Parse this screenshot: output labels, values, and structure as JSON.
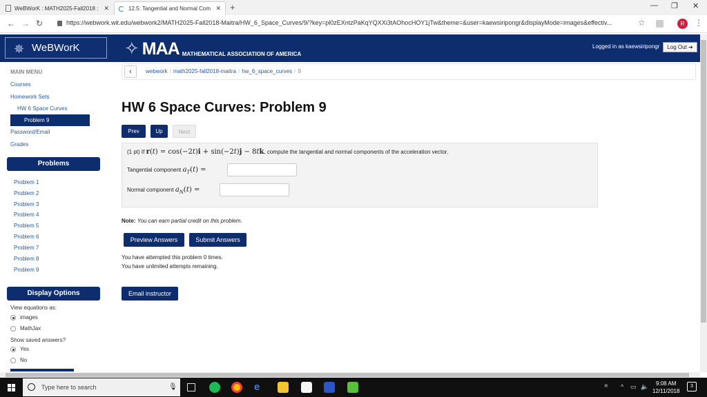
{
  "browser": {
    "tabs": [
      {
        "title": "WeBWorK : MATH2025-Fall2018 :"
      },
      {
        "title": "12.5: Tangential and Normal Com"
      }
    ],
    "new_tab": "+",
    "url": "https://webwork.wit.edu/webwork2/MATH2025-Fall2018-Maitra/HW_6_Space_Curves/9/?key=pl0zEXntzPaKqYQXXi3tAOhocHOY1jTw&theme=&user=kaewsiripongr&displayMode=images&effectiv...",
    "profile_initial": "R"
  },
  "header": {
    "app_name": "WeBWorK",
    "maa_name": "MAA",
    "maa_subtitle": "MATHEMATICAL ASSOCIATION OF AMERICA",
    "logged_in": "Logged in as kaewsiripongr",
    "logout_label": "Log Out ➜"
  },
  "sidebar": {
    "main_menu": "MAIN MENU",
    "courses": "Courses",
    "homework_sets": "Homework Sets",
    "current_set": "HW 6 Space Curves",
    "current_problem": "Problem 9",
    "password_email": "Password/Email",
    "grades": "Grades",
    "problems_header": "Problems",
    "problems": [
      "Problem 1",
      "Problem 2",
      "Problem 3",
      "Problem 4",
      "Problem 5",
      "Problem 6",
      "Problem 7",
      "Problem 8",
      "Problem 9"
    ],
    "display_header": "Display Options",
    "view_equations": "View equations as:",
    "eq_options": [
      "images",
      "MathJax"
    ],
    "eq_selected": "images",
    "show_saved": "Show saved answers?",
    "saved_options": [
      "Yes",
      "No"
    ],
    "saved_selected": "Yes"
  },
  "breadcrumb": {
    "items": [
      "webwork",
      "math2025-fall2018-maitra",
      "hw_6_space_curves"
    ],
    "current": "9"
  },
  "main": {
    "title": "HW 6 Space Curves: Problem 9",
    "prev_label": "Prev",
    "up_label": "Up",
    "next_label": "Next",
    "problem_points": "(1 pt) If",
    "problem_text": ", compute the tangential and normal components of the acceleration vector.",
    "tangential_label": "Tangential component",
    "normal_label": "Normal component",
    "tangential_value": "",
    "normal_value": "",
    "note_bold": "Note:",
    "note_text": "You can earn partial credit on this problem.",
    "preview_label": "Preview Answers",
    "submit_label": "Submit Answers",
    "attempts_line1": "You have attempted this problem 0 times.",
    "attempts_line2": "You have unlimited attempts remaining.",
    "email_label": "Email instructor"
  },
  "taskbar": {
    "search_placeholder": "Type here to search",
    "time": "9:08 AM",
    "date": "12/11/2018",
    "notification_count": "3"
  }
}
